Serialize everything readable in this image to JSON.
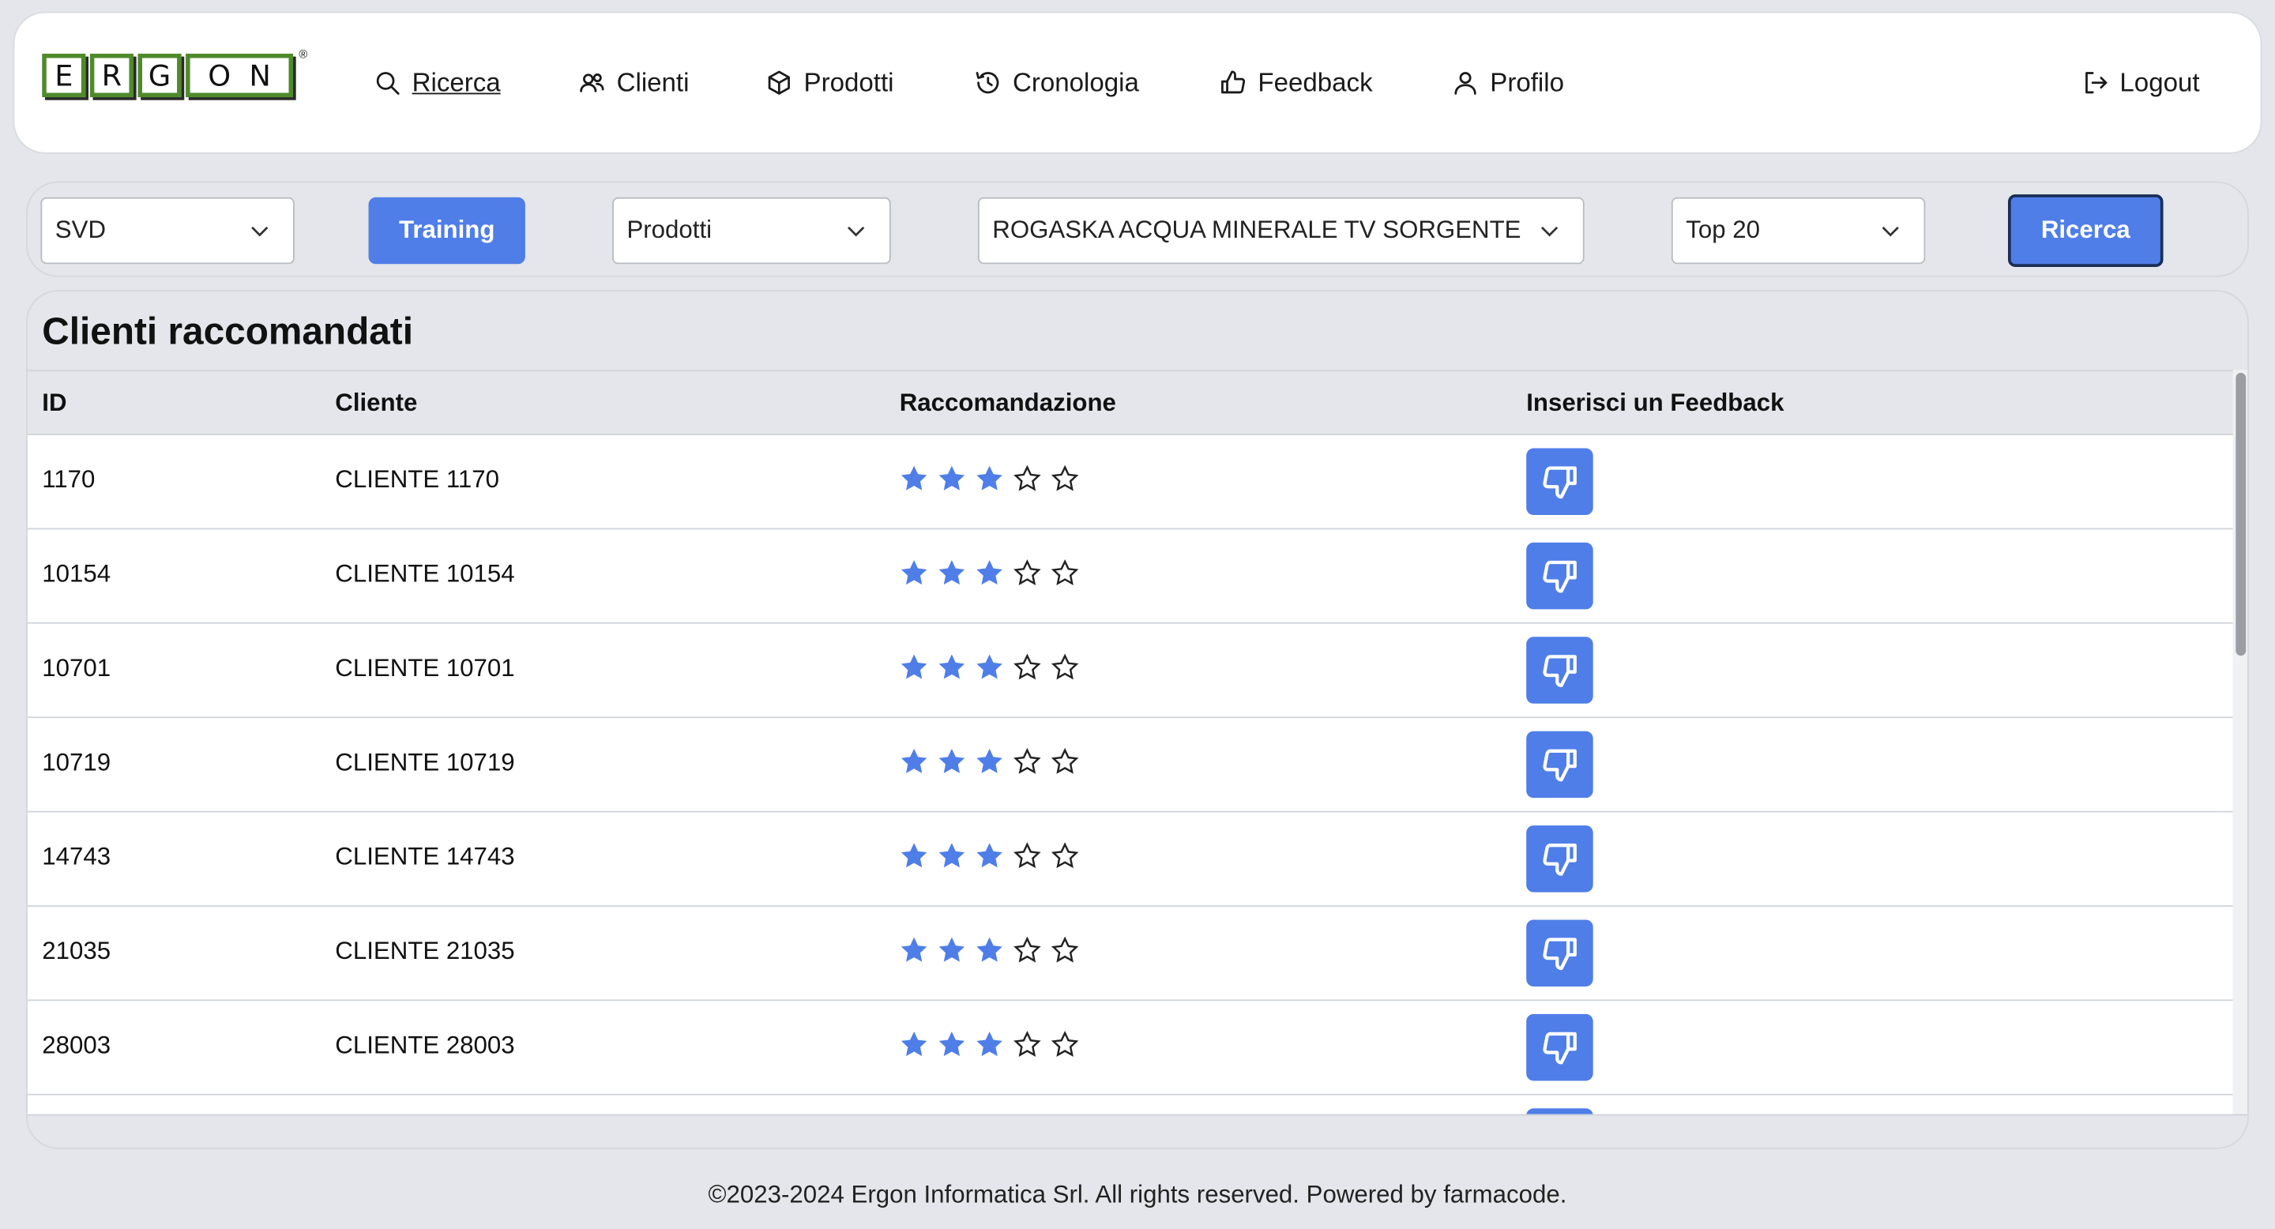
{
  "logo": {
    "letters": [
      "E",
      "R",
      "G",
      "O",
      "N"
    ],
    "registered": "®"
  },
  "nav": {
    "items": [
      {
        "label": "Ricerca",
        "icon": "search-icon"
      },
      {
        "label": "Clienti",
        "icon": "users-icon"
      },
      {
        "label": "Prodotti",
        "icon": "box-icon"
      },
      {
        "label": "Cronologia",
        "icon": "history-icon"
      },
      {
        "label": "Feedback",
        "icon": "thumbs-up-icon"
      },
      {
        "label": "Profilo",
        "icon": "user-icon"
      }
    ],
    "logout": "Logout"
  },
  "filters": {
    "algorithm": "SVD",
    "training_label": "Training",
    "entity": "Prodotti",
    "product": "ROGASKA ACQUA MINERALE TV SORGENTE",
    "top": "Top 20",
    "search_label": "Ricerca"
  },
  "table": {
    "title": "Clienti raccomandati",
    "headers": {
      "id": "ID",
      "cliente": "Cliente",
      "raccomandazione": "Raccomandazione",
      "feedback": "Inserisci un Feedback"
    },
    "max_rating": 5,
    "rows": [
      {
        "id": "1170",
        "cliente": "CLIENTE 1170",
        "rating": 3
      },
      {
        "id": "10154",
        "cliente": "CLIENTE 10154",
        "rating": 3
      },
      {
        "id": "10701",
        "cliente": "CLIENTE 10701",
        "rating": 3
      },
      {
        "id": "10719",
        "cliente": "CLIENTE 10719",
        "rating": 3
      },
      {
        "id": "14743",
        "cliente": "CLIENTE 14743",
        "rating": 3
      },
      {
        "id": "21035",
        "cliente": "CLIENTE 21035",
        "rating": 3
      },
      {
        "id": "28003",
        "cliente": "CLIENTE 28003",
        "rating": 3
      },
      {
        "id": "",
        "cliente": "",
        "rating": 0
      }
    ]
  },
  "footer": "©2023-2024 Ergon Informatica Srl. All rights reserved. Powered by farmacode.",
  "colors": {
    "accent": "#4f7ee8",
    "background": "#e4e6eb",
    "logo_green": "#4f8a2b"
  }
}
